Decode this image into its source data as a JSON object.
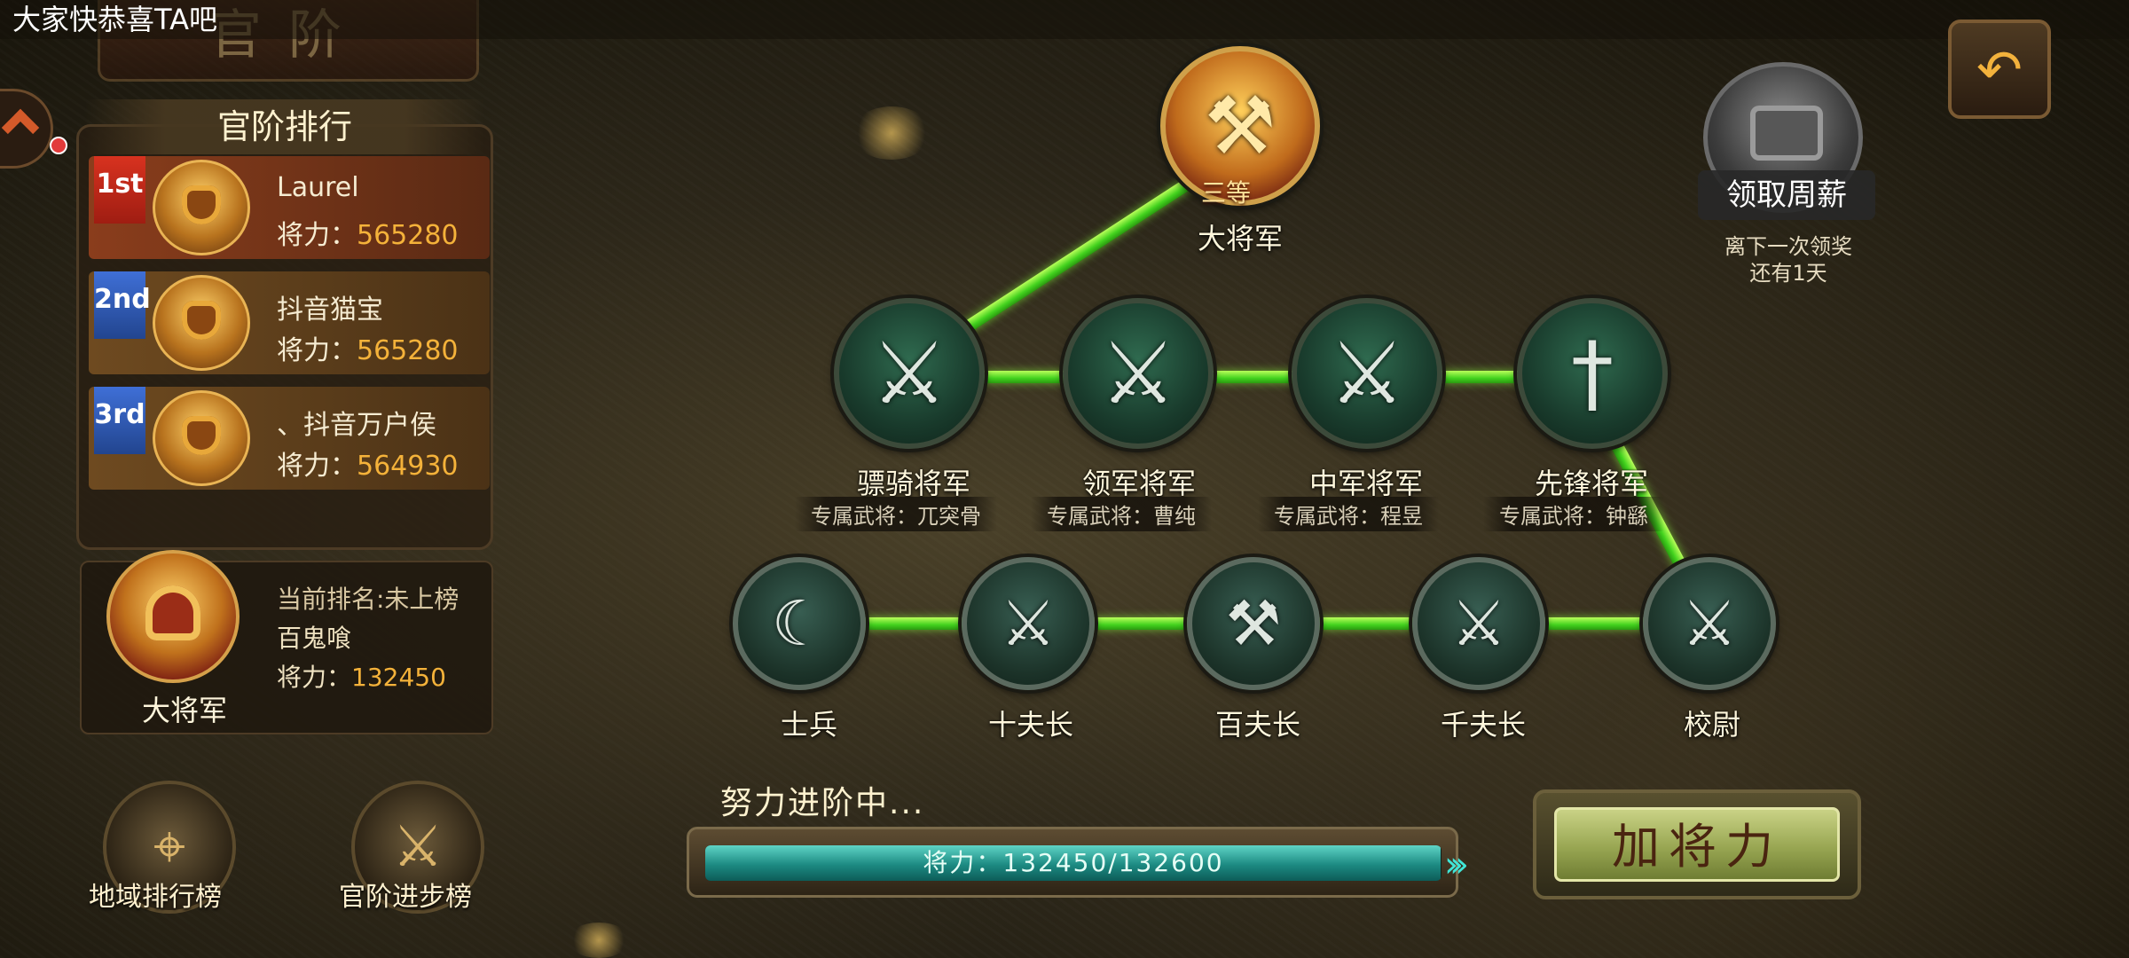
{
  "marquee": "大家快恭喜TA吧",
  "title": "官阶",
  "leaderboard": {
    "header": "官阶排行",
    "power_label": "将力：",
    "entries": [
      {
        "badge": "1st",
        "name": "Laurel",
        "power": "565280"
      },
      {
        "badge": "2nd",
        "name": "抖音猫宝",
        "power": "565280"
      },
      {
        "badge": "3rd",
        "name": "、抖音万户侯",
        "power": "564930"
      }
    ],
    "me": {
      "rank_text": "当前排名:未上榜",
      "name": "百鬼喰",
      "power_label": "将力：",
      "power": "132450",
      "title": "大将军"
    }
  },
  "bottom_buttons": {
    "region": "地域排行榜",
    "progress": "官阶进步榜"
  },
  "tree": {
    "top": {
      "label": "大将军",
      "grade": "三等"
    },
    "exclusive_prefix": "专属武将：",
    "generals": [
      {
        "label": "骠骑将军",
        "exclusive": "专属武将：兀突骨"
      },
      {
        "label": "领军将军",
        "exclusive": "专属武将：曹纯"
      },
      {
        "label": "中军将军",
        "exclusive": "专属武将：程昱"
      },
      {
        "label": "先锋将军",
        "exclusive": "专属武将：钟繇"
      }
    ],
    "ranks": [
      "士兵",
      "十夫长",
      "百夫长",
      "千夫长",
      "校尉"
    ]
  },
  "weekly": {
    "label": "领取周薪",
    "note_line1": "离下一次领奖",
    "note_line2": "还有1天"
  },
  "progress": {
    "caption": "努力进阶中...",
    "text": "将力：132450/132600",
    "fraction": 0.9989
  },
  "action_button": "加将力",
  "colors": {
    "link_green": "#42d21e",
    "power_orange": "#f4b23a",
    "progress_teal": "#1c8a82"
  },
  "icons": [
    "back-arrow-icon",
    "chest-icon",
    "map-pin-icon",
    "swords-up-icon"
  ]
}
